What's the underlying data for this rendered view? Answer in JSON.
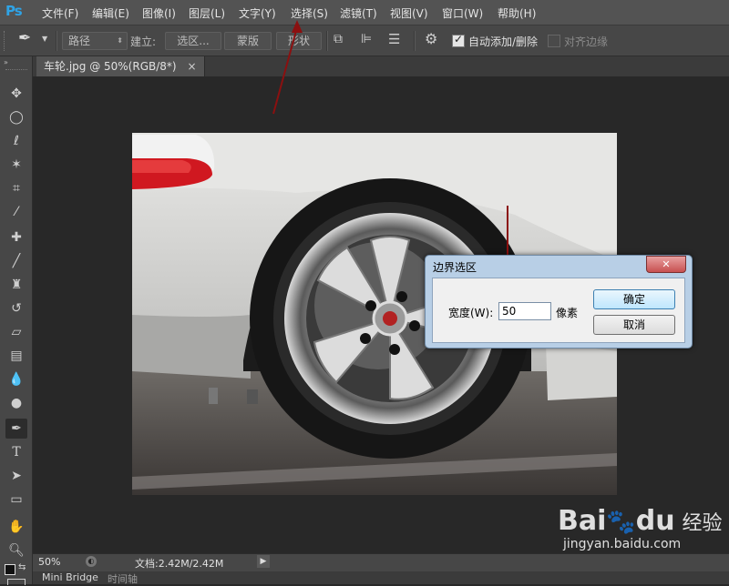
{
  "app": {
    "logo": "Ps"
  },
  "menu": [
    "文件(F)",
    "编辑(E)",
    "图像(I)",
    "图层(L)",
    "文字(Y)",
    "选择(S)",
    "滤镜(T)",
    "视图(V)",
    "窗口(W)",
    "帮助(H)"
  ],
  "options": {
    "mode_select": "路径",
    "make_label": "建立:",
    "selection_btn": "选区...",
    "mask_btn": "蒙版",
    "shape_btn": "形状",
    "auto_add_delete": "自动添加/删除",
    "auto_add_checked": true,
    "align_edges": "对齐边缘",
    "align_edges_checked": false
  },
  "document": {
    "tab_title": "车轮.jpg @ 50%(RGB/8*)",
    "close_glyph": "×"
  },
  "status": {
    "zoom": "50%",
    "doc_info": "文档:2.42M/2.42M"
  },
  "bottom_tabs": [
    "Mini Bridge",
    "时间轴"
  ],
  "dialog": {
    "title": "边界选区",
    "close_glyph": "✕",
    "width_label": "宽度(W):",
    "width_value": "50",
    "unit": "像素",
    "ok": "确定",
    "cancel": "取消"
  },
  "watermark": {
    "brand": "Bai",
    "brand2": "du",
    "cn": "经验",
    "url": "jingyan.baidu.com"
  },
  "colors": {
    "accent": "#2fa3e6",
    "arrow": "#8b1010"
  }
}
